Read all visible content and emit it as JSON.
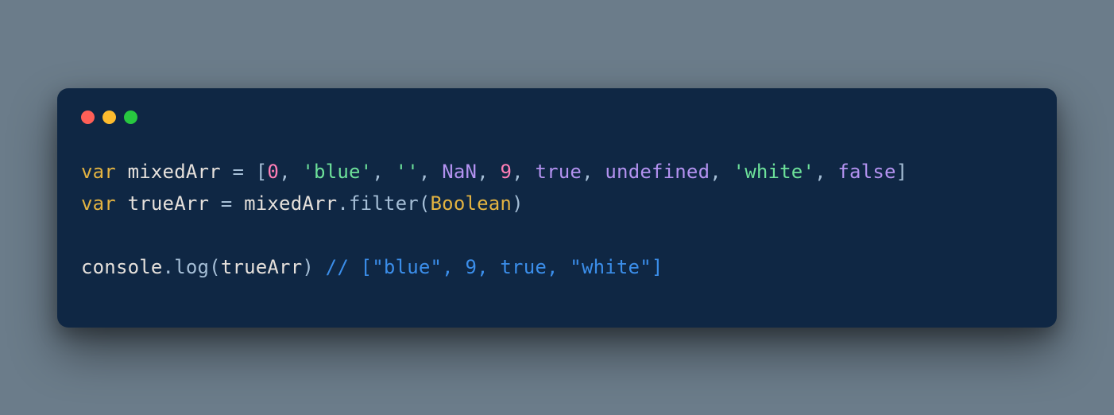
{
  "code": {
    "line1": {
      "kw1": "var",
      "sp": " ",
      "var1": "mixedArr",
      "eq": " = ",
      "lbr": "[",
      "n0": "0",
      "c1": ", ",
      "s_blue": "'blue'",
      "c2": ", ",
      "s_empty": "''",
      "c3": ", ",
      "nan": "NaN",
      "c4": ", ",
      "n9": "9",
      "c5": ", ",
      "true": "true",
      "c6": ", ",
      "undef": "undefined",
      "c7": ", ",
      "s_white": "'white'",
      "c8": ", ",
      "false": "false",
      "rbr": "]"
    },
    "line2": {
      "kw1": "var",
      "sp": " ",
      "var1": "trueArr",
      "eq": " = ",
      "var2": "mixedArr",
      "dot": ".",
      "fn": "filter",
      "lp": "(",
      "cls": "Boolean",
      "rp": ")"
    },
    "line4": {
      "obj": "console",
      "dot": ".",
      "fn": "log",
      "lp": "(",
      "arg": "trueArr",
      "rp": ")",
      "sp": " ",
      "cmt": "// [\"blue\", 9, true, \"white\"]"
    }
  }
}
